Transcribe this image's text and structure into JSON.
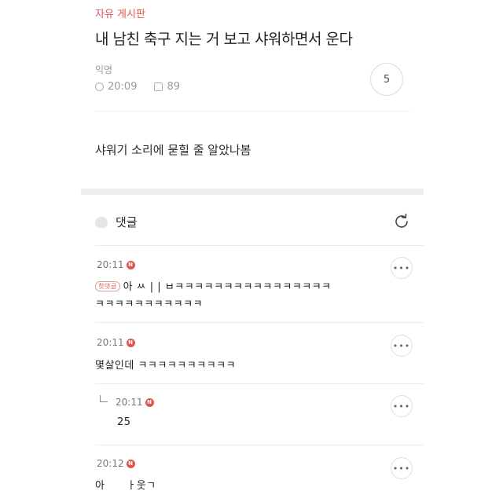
{
  "post": {
    "board": "자유 게시판",
    "title": "내 남친 축구 지는 거 보고 샤워하면서 운다",
    "author": "익명",
    "time": "20:09",
    "views": "89",
    "comment_count": "5",
    "body": "샤워기 소리에 묻힐 줄 알았나봄"
  },
  "comments_section": {
    "label": "댓글"
  },
  "comments": [
    {
      "time": "20:11",
      "badge": "N",
      "first_tag": "첫댓글",
      "line1": "아 ㅆ | | ㅂㅋㅋㅋㅋㅋㅋㅋㅋㅋㅋㅋㅋㅋㅋㅋㅋ",
      "line2": "ㅋㅋㅋㅋㅋㅋㅋㅋㅋㅋㅋ",
      "more": "•••"
    },
    {
      "time": "20:11",
      "badge": "N",
      "text": "몇살인데 ㅋㅋㅋㅋㅋㅋㅋㅋㅋㅋ",
      "more": "•••"
    },
    {
      "time": "20:11",
      "badge": "N",
      "text": "25",
      "more": "•••"
    },
    {
      "time": "20:12",
      "badge": "N",
      "text": "아      ㅏ웃ㄱ",
      "more": "•••"
    }
  ]
}
